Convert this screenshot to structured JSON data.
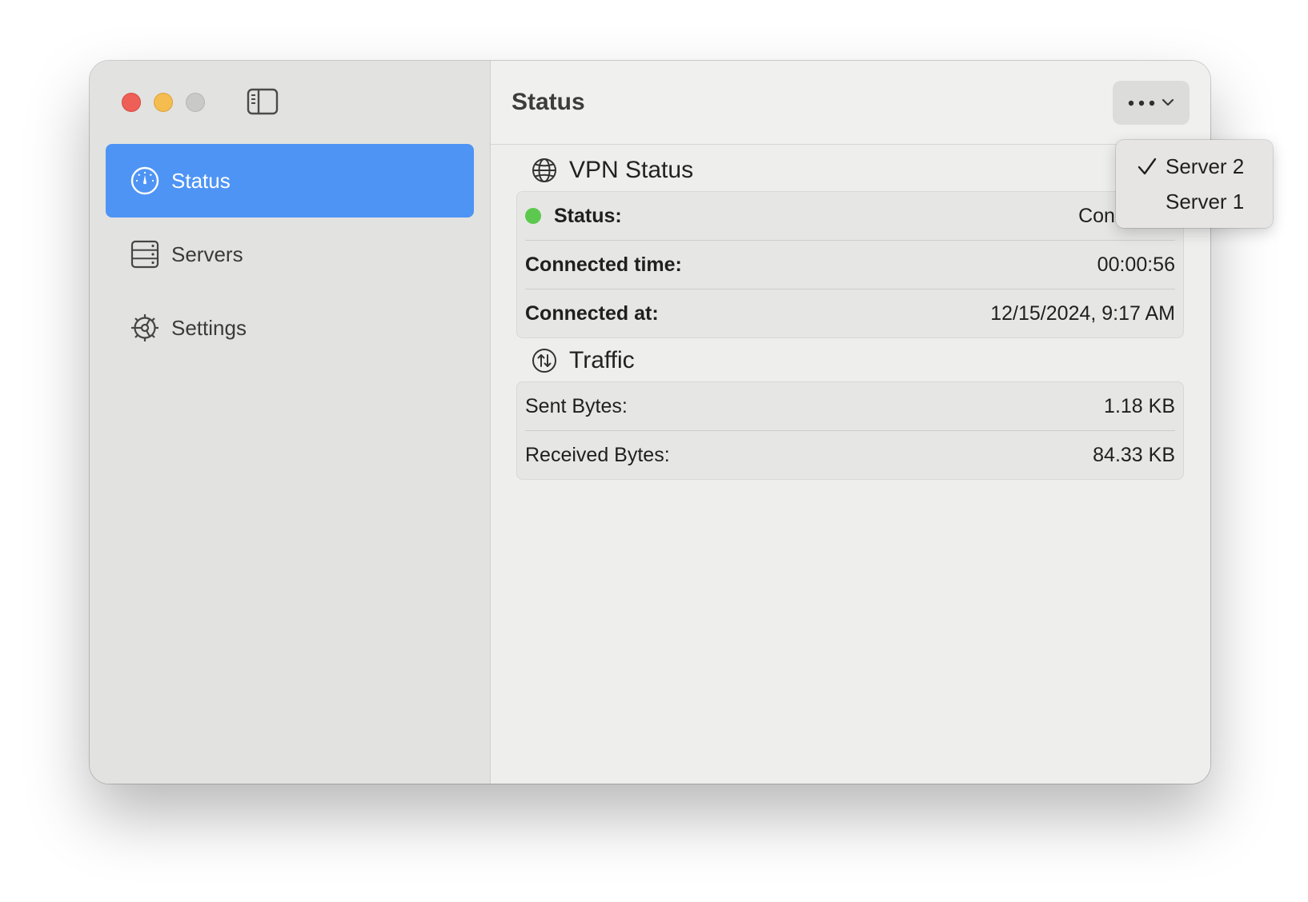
{
  "sidebar": {
    "items": [
      {
        "label": "Status",
        "icon": "gauge-icon",
        "active": true
      },
      {
        "label": "Servers",
        "icon": "server-rack-icon",
        "active": false
      },
      {
        "label": "Settings",
        "icon": "gear-icon",
        "active": false
      }
    ]
  },
  "toolbar": {
    "title": "Status",
    "more_icon": "ellipsis-icon",
    "chevron_icon": "chevron-down-icon"
  },
  "vpn_status": {
    "header": "VPN Status",
    "icon": "globe-icon",
    "rows": [
      {
        "label": "Status:",
        "value": "Connected",
        "indicator_color": "#5cc94e"
      },
      {
        "label": "Connected time:",
        "value": "00:00:56"
      },
      {
        "label": "Connected at:",
        "value": "12/15/2024, 9:17 AM"
      }
    ]
  },
  "traffic": {
    "header": "Traffic",
    "icon": "arrows-up-down-circle-icon",
    "rows": [
      {
        "label": "Sent Bytes:",
        "value": "1.18 KB"
      },
      {
        "label": "Received Bytes:",
        "value": "84.33 KB"
      }
    ]
  },
  "server_menu": {
    "items": [
      {
        "label": "Server 2",
        "checked": true
      },
      {
        "label": "Server 1",
        "checked": false
      }
    ]
  },
  "colors": {
    "accent": "#4e94f5",
    "status_green": "#5cc94e",
    "close": "#ee5f57",
    "minimize": "#f5bd4f"
  }
}
